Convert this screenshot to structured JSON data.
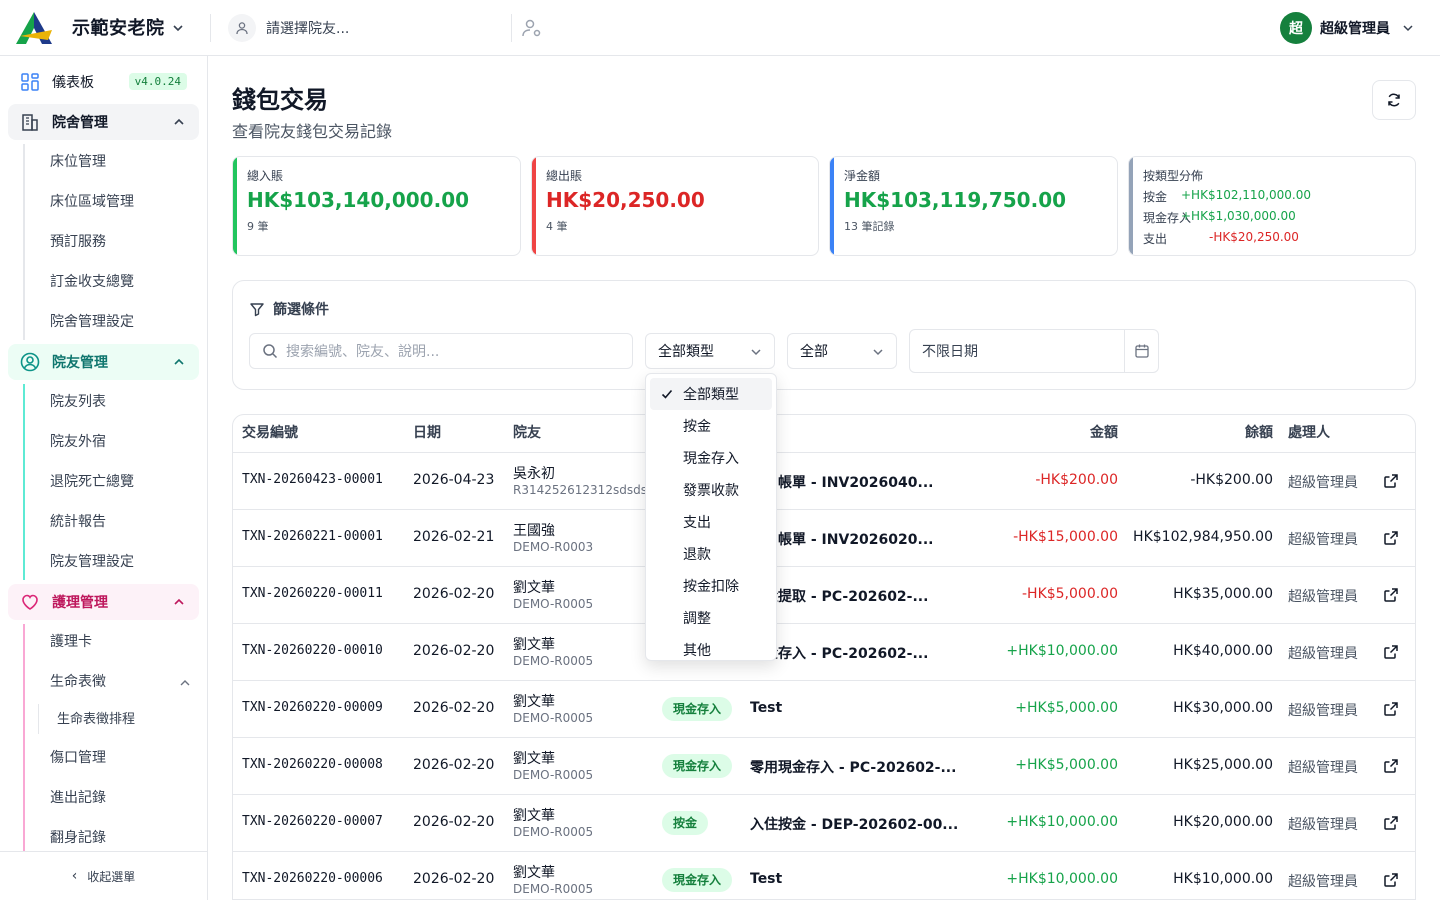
{
  "topbar": {
    "org_name": "示範安老院",
    "resident_placeholder": "請選擇院友...",
    "user_initial": "超",
    "user_name": "超級管理員"
  },
  "sidebar": {
    "dashboard": {
      "label": "儀表板",
      "version": "v4.0.24"
    },
    "groups": [
      {
        "label": "院舍管理",
        "items": [
          "床位管理",
          "床位區域管理",
          "預訂服務",
          "訂金收支總覽",
          "院舍管理設定"
        ]
      },
      {
        "label": "院友管理",
        "items": [
          "院友列表",
          "院友外宿",
          "退院死亡總覽",
          "統計報告",
          "院友管理設定"
        ]
      },
      {
        "label": "護理管理",
        "items": [
          "護理卡",
          "生命表徵",
          "生命表徵排程",
          "傷口管理",
          "進出記錄",
          "翻身記錄"
        ]
      }
    ],
    "collapse_label": "收起選單"
  },
  "page": {
    "title": "錢包交易",
    "subtitle": "查看院友錢包交易記錄"
  },
  "stats": {
    "total_in": {
      "label": "總入賬",
      "value": "HK$103,140,000.00",
      "count": "9 筆"
    },
    "total_out": {
      "label": "總出賬",
      "value": "HK$20,250.00",
      "count": "4 筆"
    },
    "net": {
      "label": "淨金額",
      "value": "HK$103,119,750.00",
      "count": "13 筆記錄"
    },
    "dist": {
      "label": "按類型分佈",
      "rows": [
        {
          "type": "按金",
          "amount": "+HK$102,110,000.00"
        },
        {
          "type": "現金存入",
          "amount": "+HK$1,030,000.00"
        },
        {
          "type": "支出",
          "amount": "-HK$20,250.00"
        }
      ]
    }
  },
  "filters": {
    "title": "篩選條件",
    "search_placeholder": "搜索編號、院友、說明...",
    "type_selected": "全部類型",
    "status_selected": "全部",
    "date_placeholder": "不限日期"
  },
  "dropdown": {
    "options": [
      "全部類型",
      "按金",
      "現金存入",
      "發票收款",
      "支出",
      "退款",
      "按金扣除",
      "調整",
      "其他"
    ],
    "selected": "全部類型"
  },
  "table": {
    "headers": {
      "id": "交易編號",
      "date": "日期",
      "resident": "院友",
      "amount": "金額",
      "balance": "餘額",
      "handler": "處理人"
    },
    "rows": [
      {
        "id": "TXN-20260423-00001",
        "date": "2026-04-23",
        "name": "吳永初",
        "code": "R314252612312sdsdsd",
        "type": "",
        "desc": "抵扣帳單 - INV2026040...",
        "amount": "-HK$200.00",
        "sign": "neg",
        "balance": "-HK$200.00",
        "handler": "超級管理員"
      },
      {
        "id": "TXN-20260221-00001",
        "date": "2026-02-21",
        "name": "王國強",
        "code": "DEMO-R0003",
        "type": "",
        "desc": "抵扣帳單 - INV2026020...",
        "amount": "-HK$15,000.00",
        "sign": "neg",
        "balance": "HK$102,984,950.00",
        "handler": "超級管理員"
      },
      {
        "id": "TXN-20260220-00011",
        "date": "2026-02-20",
        "name": "劉文華",
        "code": "DEMO-R0005",
        "type": "",
        "desc": "現金提取 - PC-202602-...",
        "amount": "-HK$5,000.00",
        "sign": "neg",
        "balance": "HK$35,000.00",
        "handler": "超級管理員"
      },
      {
        "id": "TXN-20260220-00010",
        "date": "2026-02-20",
        "name": "劉文華",
        "code": "DEMO-R0005",
        "type": "",
        "desc": "現金存入 - PC-202602-...",
        "amount": "+HK$10,000.00",
        "sign": "pos",
        "balance": "HK$40,000.00",
        "handler": "超級管理員"
      },
      {
        "id": "TXN-20260220-00009",
        "date": "2026-02-20",
        "name": "劉文華",
        "code": "DEMO-R0005",
        "type": "現金存入",
        "desc": "Test",
        "amount": "+HK$5,000.00",
        "sign": "pos",
        "balance": "HK$30,000.00",
        "handler": "超級管理員"
      },
      {
        "id": "TXN-20260220-00008",
        "date": "2026-02-20",
        "name": "劉文華",
        "code": "DEMO-R0005",
        "type": "現金存入",
        "desc": "零用現金存入 - PC-202602-...",
        "amount": "+HK$5,000.00",
        "sign": "pos",
        "balance": "HK$25,000.00",
        "handler": "超級管理員"
      },
      {
        "id": "TXN-20260220-00007",
        "date": "2026-02-20",
        "name": "劉文華",
        "code": "DEMO-R0005",
        "type": "按金",
        "desc": "入住按金 - DEP-202602-00...",
        "amount": "+HK$10,000.00",
        "sign": "pos",
        "balance": "HK$20,000.00",
        "handler": "超級管理員"
      },
      {
        "id": "TXN-20260220-00006",
        "date": "2026-02-20",
        "name": "劉文華",
        "code": "DEMO-R0005",
        "type": "現金存入",
        "desc": "Test",
        "amount": "+HK$10,000.00",
        "sign": "pos",
        "balance": "HK$10,000.00",
        "handler": "超級管理員"
      }
    ]
  },
  "colors": {
    "green": "#16a34a",
    "red": "#dc2626",
    "blue": "#3b82f6",
    "slate": "#94a3b8",
    "pink": "#ec4899",
    "teal": "#14b8a6"
  }
}
